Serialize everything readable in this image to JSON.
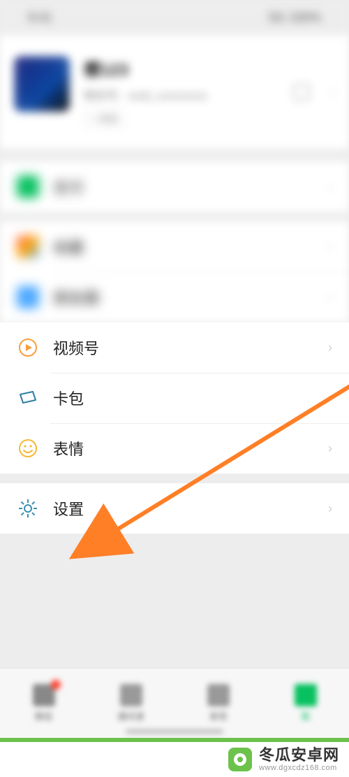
{
  "status": {
    "left": "9:41",
    "right": "5G 100%"
  },
  "profile": {
    "name": "樱123",
    "sub": "微信号：wxid_xxxxxxxxx",
    "tag": "+ 状态"
  },
  "rows": {
    "pay": "支付",
    "fav": "收藏",
    "moments": "朋友圈",
    "channels": "视频号",
    "cards": "卡包",
    "stickers": "表情",
    "settings": "设置"
  },
  "nav": {
    "chat": "微信",
    "contacts": "通讯录",
    "discover": "发现",
    "me": "我"
  },
  "watermark": {
    "name": "冬瓜安卓网",
    "url": "www.dgxcdz168.com"
  }
}
